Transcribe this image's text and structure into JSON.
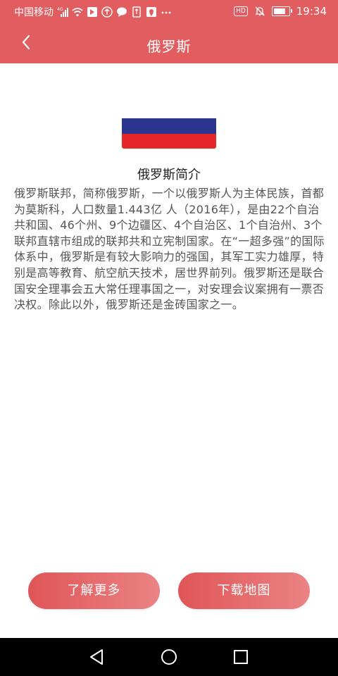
{
  "status_bar": {
    "carrier": "中国移动",
    "network": "4G",
    "hd": "HD",
    "time": "19:34",
    "icons": [
      "signal-icon",
      "wifi-icon",
      "notification-icons",
      "battery-icon"
    ]
  },
  "header": {
    "title": "俄罗斯",
    "back_icon": "chevron-left-icon"
  },
  "flag": {
    "colors": [
      "#ffffff",
      "#2b3590",
      "#e3262a"
    ]
  },
  "intro": {
    "heading": "俄罗斯简介",
    "text": "俄罗斯联邦，简称俄罗斯，一个以俄罗斯人为主体民族，首都为莫斯科，人口数量1.443亿 人（2016年），是由22个自治共和国、46个州、9个边疆区、4个自治区、1个自治州、3个联邦直辖市组成的联邦共和立宪制国家。在“一超多强”的国际体系中，俄罗斯是有较大影响力的强国，其军工实力雄厚，特别是高等教育、航空航天技术，居世界前列。俄罗斯还是联合国安全理事会五大常任理事国之一，对安理会议案拥有一票否决权。除此以外，俄罗斯还是金砖国家之一。"
  },
  "actions": {
    "more_label": "了解更多",
    "map_label": "下载地图"
  },
  "colors": {
    "accent": "#e25d5f",
    "nav_bar": "#000000"
  },
  "nav": {
    "icons": [
      "back-triangle-icon",
      "home-circle-icon",
      "recents-square-icon"
    ]
  }
}
